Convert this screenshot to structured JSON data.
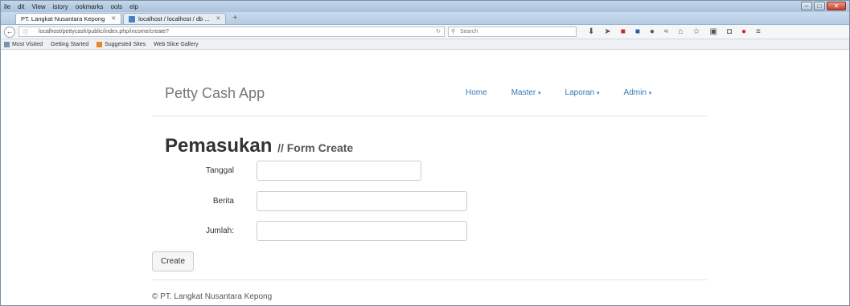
{
  "browser": {
    "menu": [
      "ile",
      "dit",
      "View",
      "istory",
      "ookmarks",
      "ools",
      "elp"
    ],
    "tabs": [
      {
        "label": "PT. Langkat Nusantara Kepong",
        "active": true
      },
      {
        "label": "localhost / localhost / db ...",
        "active": false
      }
    ],
    "new_tab": "+",
    "url": "localhost/pettycash/public/index.php/income/create?",
    "search_placeholder": "Search",
    "bookmarks": [
      "Most Visited",
      "Getting Started",
      "Suggested Sites",
      "Web Slice Gallery"
    ]
  },
  "site": {
    "brand": "Petty Cash App",
    "nav": [
      {
        "label": "Home",
        "dropdown": false
      },
      {
        "label": "Master",
        "dropdown": true
      },
      {
        "label": "Laporan",
        "dropdown": true
      },
      {
        "label": "Admin",
        "dropdown": true
      }
    ]
  },
  "form": {
    "title": "Pemasukan",
    "subtitle": "// Form Create",
    "fields": [
      {
        "label": "Tanggal",
        "value": ""
      },
      {
        "label": "Berita",
        "value": ""
      },
      {
        "label": "Jumlah:",
        "value": ""
      }
    ],
    "submit_label": "Create"
  },
  "footer": {
    "text": "© PT. Langkat Nusantara Kepong"
  },
  "colors": {
    "link": "#337ab7",
    "brand": "#777777"
  }
}
